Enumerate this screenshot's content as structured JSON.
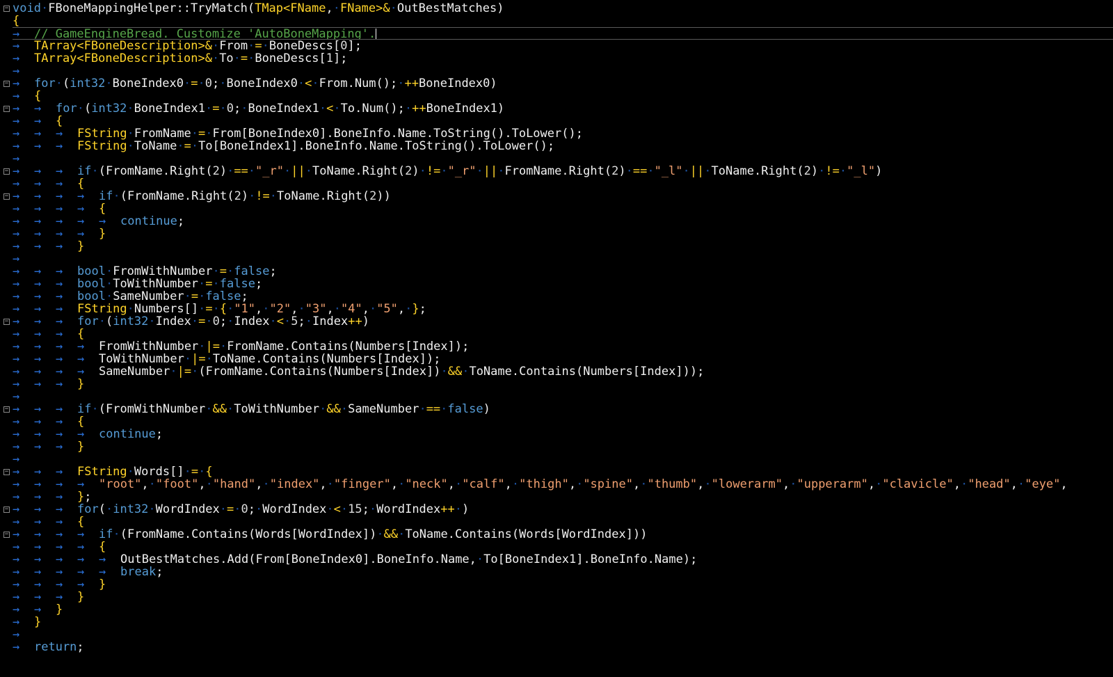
{
  "editor": {
    "lines": [
      "void FBoneMappingHelper::TryMatch(TMap<FName, FName>& OutBestMatches)",
      "{",
      "    // GameEngineBread. Customize 'AutoBoneMapping'.",
      "    TArray<FBoneDescription>& From = BoneDescs[0];",
      "    TArray<FBoneDescription>& To = BoneDescs[1];",
      "",
      "    for (int32 BoneIndex0 = 0; BoneIndex0 < From.Num(); ++BoneIndex0)",
      "    {",
      "        for (int32 BoneIndex1 = 0; BoneIndex1 < To.Num(); ++BoneIndex1)",
      "        {",
      "            FString FromName = From[BoneIndex0].BoneInfo.Name.ToString().ToLower();",
      "            FString ToName = To[BoneIndex1].BoneInfo.Name.ToString().ToLower();",
      "",
      "            if (FromName.Right(2) == \"_r\" || ToName.Right(2) != \"_r\" || FromName.Right(2) == \"_l\" || ToName.Right(2) != \"_l\")",
      "            {",
      "                if (FromName.Right(2) != ToName.Right(2))",
      "                {",
      "                    continue;",
      "                }",
      "            }",
      "",
      "            bool FromWithNumber = false;",
      "            bool ToWithNumber = false;",
      "            bool SameNumber = false;",
      "            FString Numbers[] = { \"1\", \"2\", \"3\", \"4\", \"5\", };",
      "            for (int32 Index = 0; Index < 5; Index++)",
      "            {",
      "                FromWithNumber |= FromName.Contains(Numbers[Index]);",
      "                ToWithNumber |= ToName.Contains(Numbers[Index]);",
      "                SameNumber |= (FromName.Contains(Numbers[Index]) && ToName.Contains(Numbers[Index]));",
      "            }",
      "",
      "            if (FromWithNumber && ToWithNumber && SameNumber == false)",
      "            {",
      "                continue;",
      "            }",
      "",
      "            FString Words[] = {",
      "                \"root\", \"foot\", \"hand\", \"index\", \"finger\", \"neck\", \"calf\", \"thigh\", \"spine\", \"thumb\", \"lowerarm\", \"upperarm\", \"clavicle\", \"head\", \"eye\",",
      "            };",
      "            for( int32 WordIndex = 0; WordIndex < 15; WordIndex++ )",
      "            {",
      "                if (FromName.Contains(Words[WordIndex]) && ToName.Contains(Words[WordIndex]))",
      "                {",
      "                    OutBestMatches.Add(From[BoneIndex0].BoneInfo.Name, To[BoneIndex1].BoneInfo.Name);",
      "                    break;",
      "                }",
      "            }",
      "        }",
      "    }",
      "",
      "    return;"
    ],
    "fold_marker": "−",
    "fold_rows": [
      0,
      6,
      8,
      13,
      15,
      25,
      32,
      37,
      40,
      42
    ],
    "current_row": 2,
    "colors": {
      "keyword": "#569cd6",
      "type": "#ffd42a",
      "string": "#f0a070",
      "comment": "#57a64a",
      "whitespace_marker": "#2a6fd6",
      "background": "#000000"
    }
  }
}
